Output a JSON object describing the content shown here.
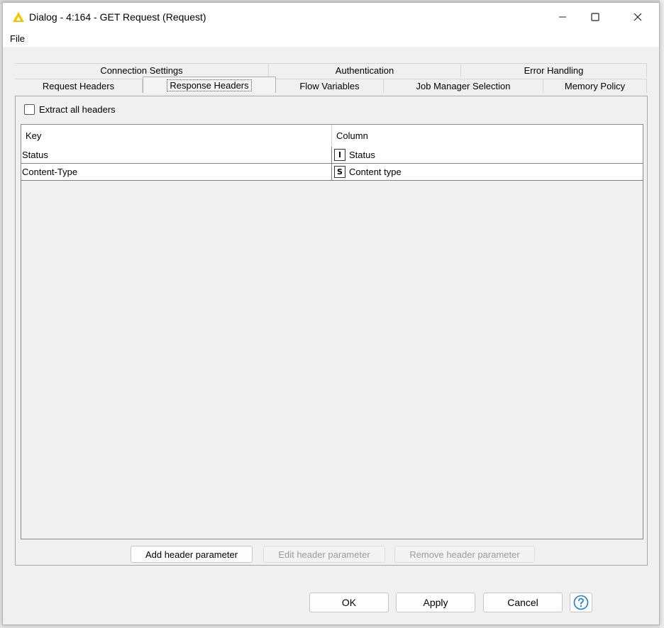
{
  "window": {
    "title": "Dialog - 4:164 - GET Request (Request)",
    "accent_color": "#f5c400"
  },
  "menu": {
    "file": "File"
  },
  "tabs": {
    "row1": [
      "Connection Settings",
      "Authentication",
      "Error Handling"
    ],
    "row2": [
      "Request Headers",
      "Response Headers",
      "Flow Variables",
      "Job Manager Selection",
      "Memory Policy"
    ],
    "selected": "Response Headers"
  },
  "extract_all_headers": {
    "label": "Extract all headers",
    "checked": false
  },
  "table": {
    "headers": {
      "key": "Key",
      "column": "Column"
    },
    "rows": [
      {
        "key": "Status",
        "type_icon": "I",
        "column": "Status"
      },
      {
        "key": "Content-Type",
        "type_icon": "S",
        "column": "Content type"
      }
    ]
  },
  "buttons": {
    "add": "Add header parameter",
    "edit": "Edit header parameter",
    "remove": "Remove header parameter",
    "ok": "OK",
    "apply": "Apply",
    "cancel": "Cancel"
  },
  "icons": {
    "app": "knime-triangle-icon",
    "help": "help-icon",
    "minimize": "minimize-icon",
    "maximize": "maximize-icon",
    "close": "close-icon"
  },
  "colors": {
    "help_blue": "#1a7fd4"
  }
}
